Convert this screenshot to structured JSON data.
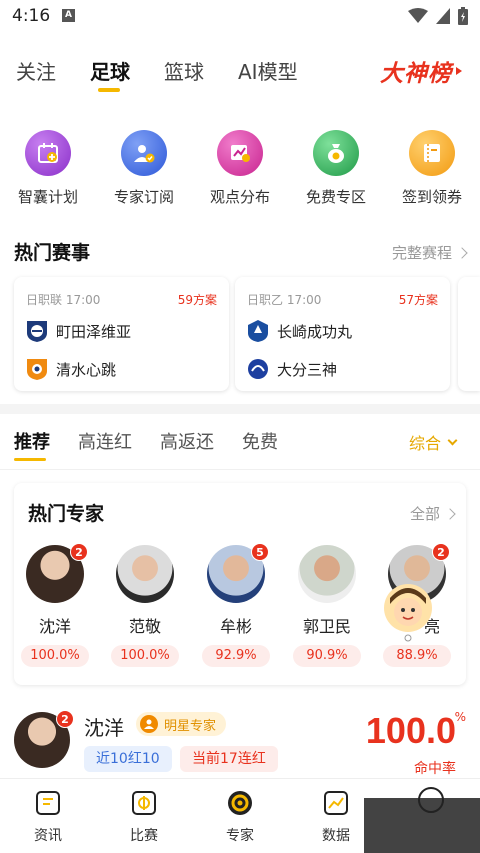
{
  "status_bar": {
    "time": "4:16",
    "notification": "A"
  },
  "top_tabs": {
    "tabs": [
      "关注",
      "足球",
      "篮球",
      "AI模型"
    ],
    "active_index": 1,
    "leaderboard_label": "大神榜"
  },
  "features": [
    {
      "label": "智囊计划",
      "icon": "calendar-plus-icon",
      "color": "#a44fdc"
    },
    {
      "label": "专家订阅",
      "icon": "user-check-icon",
      "color": "#3f6fe6"
    },
    {
      "label": "观点分布",
      "icon": "chart-share-icon",
      "color": "#e040a8"
    },
    {
      "label": "免费专区",
      "icon": "money-bag-icon",
      "color": "#34b05a"
    },
    {
      "label": "签到领券",
      "icon": "coupon-icon",
      "color": "#f5a623"
    }
  ],
  "hot_matches": {
    "title": "热门赛事",
    "more_label": "完整赛程",
    "matches": [
      {
        "league_time": "日职联 17:00",
        "plans": "59方案",
        "home": "町田泽维亚",
        "away": "清水心跳"
      },
      {
        "league_time": "日职乙 17:00",
        "plans": "57方案",
        "home": "长崎成功丸",
        "away": "大分三神"
      }
    ]
  },
  "sub_tabs": {
    "tabs": [
      "推荐",
      "高连红",
      "高返还",
      "免费"
    ],
    "active_index": 0,
    "sort_label": "综合"
  },
  "hot_experts": {
    "title": "热门专家",
    "more_label": "全部",
    "experts": [
      {
        "name": "沈洋",
        "rate": "100.0%",
        "badge": "2"
      },
      {
        "name": "范敬",
        "rate": "100.0%",
        "badge": ""
      },
      {
        "name": "牟彬",
        "rate": "92.9%",
        "badge": "5"
      },
      {
        "name": "郭卫民",
        "rate": "90.9%",
        "badge": ""
      },
      {
        "name": "亮",
        "rate": "88.9%",
        "badge": "2"
      }
    ]
  },
  "expert_row": {
    "name": "沈洋",
    "badge": "2",
    "star_label": "明星专家",
    "tag_recent": "近10红10",
    "tag_streak": "当前17连红",
    "rate": "100.0",
    "rate_unit": "%",
    "rate_label": "命中率"
  },
  "bottom_nav": [
    {
      "label": "资讯",
      "icon": "news-icon"
    },
    {
      "label": "比赛",
      "icon": "match-icon"
    },
    {
      "label": "专家",
      "icon": "expert-icon"
    },
    {
      "label": "数据",
      "icon": "data-chart-icon"
    }
  ],
  "colors": {
    "accent": "#f5b800",
    "red": "#e8321e",
    "blue": "#3a6fd8"
  }
}
